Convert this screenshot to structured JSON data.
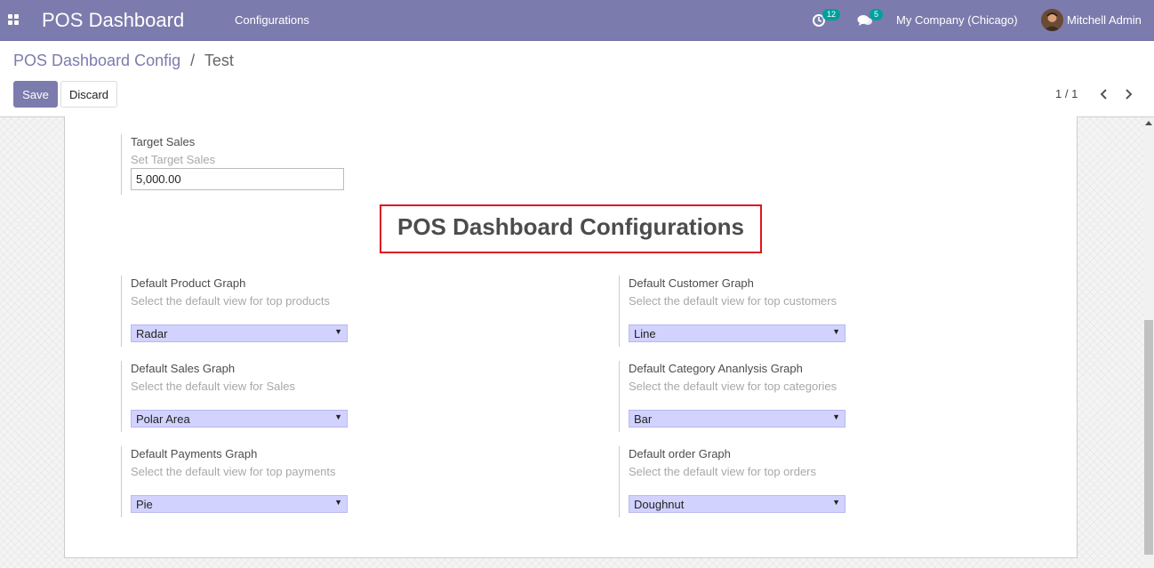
{
  "navbar": {
    "app_title": "POS Dashboard",
    "menu_configurations": "Configurations",
    "activity_count": "12",
    "messages_count": "5",
    "company": "My Company (Chicago)",
    "user_name": "Mitchell Admin"
  },
  "breadcrumb": {
    "parent": "POS Dashboard Config",
    "separator": "/",
    "current": "Test"
  },
  "buttons": {
    "save": "Save",
    "discard": "Discard"
  },
  "pager": {
    "value": "1 / 1"
  },
  "form": {
    "target_sales": {
      "label": "Target Sales",
      "help": "Set Target Sales",
      "value": "5,000.00"
    },
    "section_title": "POS Dashboard Configurations",
    "product_graph": {
      "label": "Default Product Graph",
      "help": "Select the default view for top products",
      "value": "Radar"
    },
    "customer_graph": {
      "label": "Default Customer Graph",
      "help": "Select the default view for top customers",
      "value": "Line"
    },
    "sales_graph": {
      "label": "Default Sales Graph",
      "help": "Select the default view for Sales",
      "value": "Polar Area"
    },
    "category_graph": {
      "label": "Default Category Ananlysis Graph",
      "help": "Select the default view for top categories",
      "value": "Bar"
    },
    "payments_graph": {
      "label": "Default Payments Graph",
      "help": "Select the default view for top payments",
      "value": "Pie"
    },
    "order_graph": {
      "label": "Default order Graph",
      "help": "Select the default view for top orders",
      "value": "Doughnut"
    }
  },
  "colors": {
    "navbar": "#7c7bad",
    "primary": "#7c7bad",
    "badge": "#00a09d",
    "select_bg": "#d2d2ff",
    "highlight_border": "#e0131f"
  }
}
